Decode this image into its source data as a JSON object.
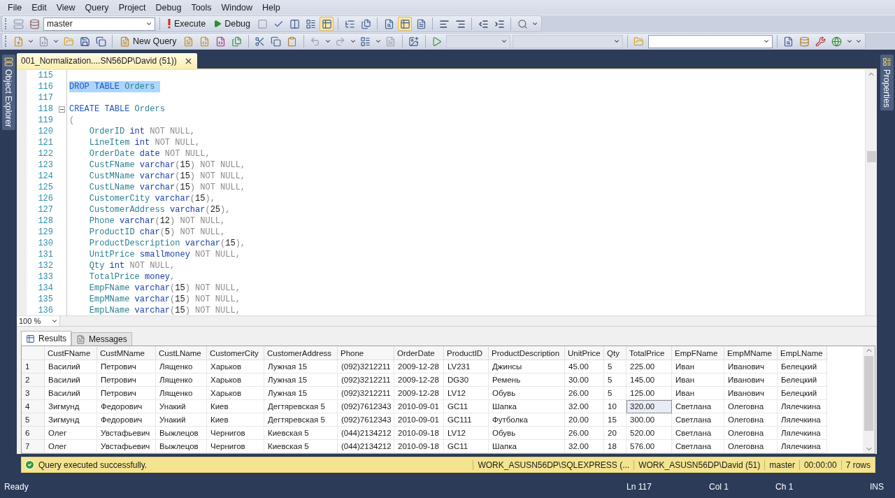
{
  "menu": [
    "File",
    "Edit",
    "View",
    "Query",
    "Project",
    "Debug",
    "Tools",
    "Window",
    "Help"
  ],
  "toolbar_sql": {
    "database": "master",
    "execute": "Execute",
    "debug": "Debug"
  },
  "toolbar_standard": {
    "new_query": "New Query"
  },
  "side_panels": {
    "left": "Object Explorer",
    "right": "Properties"
  },
  "document_tab": {
    "title": "001_Normalization....SN56DP\\David (51))"
  },
  "editor": {
    "zoom": "100 %",
    "lines": [
      {
        "number": "115",
        "selected": false,
        "fold": false
      },
      {
        "number": "116",
        "selected": true,
        "fold": false,
        "tokens": [
          {
            "kind": "keyword",
            "text": "DROP TABLE"
          },
          {
            "kind": "name",
            "text": " Orders "
          }
        ]
      },
      {
        "number": "117",
        "selected": false,
        "fold": false
      },
      {
        "number": "118",
        "selected": false,
        "fold": true,
        "tokens": [
          {
            "kind": "keyword",
            "text": "CREATE TABLE"
          },
          {
            "kind": "name",
            "text": " Orders"
          }
        ]
      },
      {
        "number": "119",
        "selected": false,
        "fold": false,
        "tokens": [
          {
            "kind": "punct",
            "text": "("
          }
        ]
      },
      {
        "number": "120",
        "selected": false,
        "fold": false,
        "tokens": [
          {
            "kind": "name",
            "text": "    OrderID"
          },
          {
            "kind": "type",
            "text": " int"
          },
          {
            "kind": "null",
            "text": " NOT NULL,"
          }
        ]
      },
      {
        "number": "121",
        "selected": false,
        "fold": false,
        "tokens": [
          {
            "kind": "name",
            "text": "    LineItem"
          },
          {
            "kind": "type",
            "text": " int"
          },
          {
            "kind": "null",
            "text": " NOT NULL,"
          }
        ]
      },
      {
        "number": "122",
        "selected": false,
        "fold": false,
        "tokens": [
          {
            "kind": "name",
            "text": "    OrderDate"
          },
          {
            "kind": "type",
            "text": " date"
          },
          {
            "kind": "null",
            "text": " NOT NULL,"
          }
        ]
      },
      {
        "number": "123",
        "selected": false,
        "fold": false,
        "tokens": [
          {
            "kind": "name",
            "text": "    CustFName"
          },
          {
            "kind": "type",
            "text": " varchar"
          },
          {
            "kind": "punct",
            "text": "("
          },
          {
            "kind": "number",
            "text": "15"
          },
          {
            "kind": "punct",
            "text": ")"
          },
          {
            "kind": "null",
            "text": " NOT NULL,"
          }
        ]
      },
      {
        "number": "124",
        "selected": false,
        "fold": false,
        "tokens": [
          {
            "kind": "name",
            "text": "    CustMName"
          },
          {
            "kind": "type",
            "text": " varchar"
          },
          {
            "kind": "punct",
            "text": "("
          },
          {
            "kind": "number",
            "text": "15"
          },
          {
            "kind": "punct",
            "text": ")"
          },
          {
            "kind": "null",
            "text": " NOT NULL,"
          }
        ]
      },
      {
        "number": "125",
        "selected": false,
        "fold": false,
        "tokens": [
          {
            "kind": "name",
            "text": "    CustLName"
          },
          {
            "kind": "type",
            "text": " varchar"
          },
          {
            "kind": "punct",
            "text": "("
          },
          {
            "kind": "number",
            "text": "15"
          },
          {
            "kind": "punct",
            "text": ")"
          },
          {
            "kind": "null",
            "text": " NOT NULL,"
          }
        ]
      },
      {
        "number": "126",
        "selected": false,
        "fold": false,
        "tokens": [
          {
            "kind": "name",
            "text": "    CustomerCity"
          },
          {
            "kind": "type",
            "text": " varchar"
          },
          {
            "kind": "punct",
            "text": "("
          },
          {
            "kind": "number",
            "text": "15"
          },
          {
            "kind": "punct",
            "text": "),"
          }
        ]
      },
      {
        "number": "127",
        "selected": false,
        "fold": false,
        "tokens": [
          {
            "kind": "name",
            "text": "    CustomerAddress"
          },
          {
            "kind": "type",
            "text": " varchar"
          },
          {
            "kind": "punct",
            "text": "("
          },
          {
            "kind": "number",
            "text": "25"
          },
          {
            "kind": "punct",
            "text": "),"
          }
        ]
      },
      {
        "number": "128",
        "selected": false,
        "fold": false,
        "tokens": [
          {
            "kind": "name",
            "text": "    Phone"
          },
          {
            "kind": "type",
            "text": " varchar"
          },
          {
            "kind": "punct",
            "text": "("
          },
          {
            "kind": "number",
            "text": "12"
          },
          {
            "kind": "punct",
            "text": ")"
          },
          {
            "kind": "null",
            "text": " NOT NULL,"
          }
        ]
      },
      {
        "number": "129",
        "selected": false,
        "fold": false,
        "tokens": [
          {
            "kind": "name",
            "text": "    ProductID"
          },
          {
            "kind": "type",
            "text": " char"
          },
          {
            "kind": "punct",
            "text": "("
          },
          {
            "kind": "number",
            "text": "5"
          },
          {
            "kind": "punct",
            "text": ")"
          },
          {
            "kind": "null",
            "text": " NOT NULL,"
          }
        ]
      },
      {
        "number": "130",
        "selected": false,
        "fold": false,
        "tokens": [
          {
            "kind": "name",
            "text": "    ProductDescription"
          },
          {
            "kind": "type",
            "text": " varchar"
          },
          {
            "kind": "punct",
            "text": "("
          },
          {
            "kind": "number",
            "text": "15"
          },
          {
            "kind": "punct",
            "text": "),"
          }
        ]
      },
      {
        "number": "131",
        "selected": false,
        "fold": false,
        "tokens": [
          {
            "kind": "name",
            "text": "    UnitPrice"
          },
          {
            "kind": "type",
            "text": " smallmoney"
          },
          {
            "kind": "null",
            "text": " NOT NULL,"
          }
        ]
      },
      {
        "number": "132",
        "selected": false,
        "fold": false,
        "tokens": [
          {
            "kind": "name",
            "text": "    Qty"
          },
          {
            "kind": "type",
            "text": " int"
          },
          {
            "kind": "null",
            "text": " NOT NULL,"
          }
        ]
      },
      {
        "number": "133",
        "selected": false,
        "fold": false,
        "tokens": [
          {
            "kind": "name",
            "text": "    TotalPrice"
          },
          {
            "kind": "type",
            "text": " money"
          },
          {
            "kind": "punct",
            "text": ","
          }
        ]
      },
      {
        "number": "134",
        "selected": false,
        "fold": false,
        "tokens": [
          {
            "kind": "name",
            "text": "    EmpFName"
          },
          {
            "kind": "type",
            "text": " varchar"
          },
          {
            "kind": "punct",
            "text": "("
          },
          {
            "kind": "number",
            "text": "15"
          },
          {
            "kind": "punct",
            "text": ")"
          },
          {
            "kind": "null",
            "text": " NOT NULL,"
          }
        ]
      },
      {
        "number": "135",
        "selected": false,
        "fold": false,
        "tokens": [
          {
            "kind": "name",
            "text": "    EmpMName"
          },
          {
            "kind": "type",
            "text": " varchar"
          },
          {
            "kind": "punct",
            "text": "("
          },
          {
            "kind": "number",
            "text": "15"
          },
          {
            "kind": "punct",
            "text": ")"
          },
          {
            "kind": "null",
            "text": " NOT NULL,"
          }
        ]
      },
      {
        "number": "136",
        "selected": false,
        "fold": false,
        "tokens": [
          {
            "kind": "name",
            "text": "    EmpLName"
          },
          {
            "kind": "type",
            "text": " varchar"
          },
          {
            "kind": "punct",
            "text": "("
          },
          {
            "kind": "number",
            "text": "15"
          },
          {
            "kind": "punct",
            "text": ")"
          },
          {
            "kind": "null",
            "text": " NOT NULL,"
          }
        ]
      }
    ]
  },
  "result_tabs": [
    {
      "label": "Results",
      "selected": true
    },
    {
      "label": "Messages",
      "selected": false
    }
  ],
  "results_grid": {
    "columns": [
      "CustFName",
      "CustMName",
      "CustLName",
      "CustomerCity",
      "CustomerAddress",
      "Phone",
      "OrderDate",
      "ProductID",
      "ProductDescription",
      "UnitPrice",
      "Qty",
      "TotalPrice",
      "EmpFName",
      "EmpMName",
      "EmpLName"
    ],
    "rows": [
      {
        "number": "1",
        "cells": [
          {
            "text": "Василий",
            "selected": false
          },
          {
            "text": "Петрович",
            "selected": false
          },
          {
            "text": "Лященко",
            "selected": false
          },
          {
            "text": "Харьков",
            "selected": false
          },
          {
            "text": "Лужная 15",
            "selected": false
          },
          {
            "text": "(092)3212211",
            "selected": false
          },
          {
            "text": "2009-12-28",
            "selected": false
          },
          {
            "text": "LV231",
            "selected": false
          },
          {
            "text": "Джинсы",
            "selected": false
          },
          {
            "text": "45.00",
            "selected": false
          },
          {
            "text": "5",
            "selected": false
          },
          {
            "text": "225.00",
            "selected": false
          },
          {
            "text": "Иван",
            "selected": false
          },
          {
            "text": "Иванович",
            "selected": false
          },
          {
            "text": "Белецкий",
            "selected": false
          }
        ]
      },
      {
        "number": "2",
        "cells": [
          {
            "text": "Василий",
            "selected": false
          },
          {
            "text": "Петрович",
            "selected": false
          },
          {
            "text": "Лященко",
            "selected": false
          },
          {
            "text": "Харьков",
            "selected": false
          },
          {
            "text": "Лужная 15",
            "selected": false
          },
          {
            "text": "(092)3212211",
            "selected": false
          },
          {
            "text": "2009-12-28",
            "selected": false
          },
          {
            "text": "DG30",
            "selected": false
          },
          {
            "text": "Ремень",
            "selected": false
          },
          {
            "text": "30.00",
            "selected": false
          },
          {
            "text": "5",
            "selected": false
          },
          {
            "text": "145.00",
            "selected": false
          },
          {
            "text": "Иван",
            "selected": false
          },
          {
            "text": "Иванович",
            "selected": false
          },
          {
            "text": "Белецкий",
            "selected": false
          }
        ]
      },
      {
        "number": "3",
        "cells": [
          {
            "text": "Василий",
            "selected": false
          },
          {
            "text": "Петрович",
            "selected": false
          },
          {
            "text": "Лященко",
            "selected": false
          },
          {
            "text": "Харьков",
            "selected": false
          },
          {
            "text": "Лужная 15",
            "selected": false
          },
          {
            "text": "(092)3212211",
            "selected": false
          },
          {
            "text": "2009-12-28",
            "selected": false
          },
          {
            "text": "LV12",
            "selected": false
          },
          {
            "text": "Обувь",
            "selected": false
          },
          {
            "text": "26.00",
            "selected": false
          },
          {
            "text": "5",
            "selected": false
          },
          {
            "text": "125.00",
            "selected": false
          },
          {
            "text": "Иван",
            "selected": false
          },
          {
            "text": "Иванович",
            "selected": false
          },
          {
            "text": "Белецкий",
            "selected": false
          }
        ]
      },
      {
        "number": "4",
        "cells": [
          {
            "text": "Зигмунд",
            "selected": false
          },
          {
            "text": "Федорович",
            "selected": false
          },
          {
            "text": "Унакий",
            "selected": false
          },
          {
            "text": "Киев",
            "selected": false
          },
          {
            "text": "Дегтяревская 5",
            "selected": false
          },
          {
            "text": "(092)7612343",
            "selected": false
          },
          {
            "text": "2010-09-01",
            "selected": false
          },
          {
            "text": "GC11",
            "selected": false
          },
          {
            "text": "Шапка",
            "selected": false
          },
          {
            "text": "32.00",
            "selected": false
          },
          {
            "text": "10",
            "selected": false
          },
          {
            "text": "320.00",
            "selected": true
          },
          {
            "text": "Светлана",
            "selected": false
          },
          {
            "text": "Олеговна",
            "selected": false
          },
          {
            "text": "Лялечкина",
            "selected": false
          }
        ]
      },
      {
        "number": "5",
        "cells": [
          {
            "text": "Зигмунд",
            "selected": false
          },
          {
            "text": "Федорович",
            "selected": false
          },
          {
            "text": "Унакий",
            "selected": false
          },
          {
            "text": "Киев",
            "selected": false
          },
          {
            "text": "Дегтяревская 5",
            "selected": false
          },
          {
            "text": "(092)7612343",
            "selected": false
          },
          {
            "text": "2010-09-01",
            "selected": false
          },
          {
            "text": "GC111",
            "selected": false
          },
          {
            "text": "Футболка",
            "selected": false
          },
          {
            "text": "20.00",
            "selected": false
          },
          {
            "text": "15",
            "selected": false
          },
          {
            "text": "300.00",
            "selected": false
          },
          {
            "text": "Светлана",
            "selected": false
          },
          {
            "text": "Олеговна",
            "selected": false
          },
          {
            "text": "Лялечкина",
            "selected": false
          }
        ]
      },
      {
        "number": "6",
        "cells": [
          {
            "text": "Олег",
            "selected": false
          },
          {
            "text": "Увстафьевич",
            "selected": false
          },
          {
            "text": "Выжлецов",
            "selected": false
          },
          {
            "text": "Чернигов",
            "selected": false
          },
          {
            "text": "Киевская 5",
            "selected": false
          },
          {
            "text": "(044)2134212",
            "selected": false
          },
          {
            "text": "2010-09-18",
            "selected": false
          },
          {
            "text": "LV12",
            "selected": false
          },
          {
            "text": "Обувь",
            "selected": false
          },
          {
            "text": "26.00",
            "selected": false
          },
          {
            "text": "20",
            "selected": false
          },
          {
            "text": "520.00",
            "selected": false
          },
          {
            "text": "Светлана",
            "selected": false
          },
          {
            "text": "Олеговна",
            "selected": false
          },
          {
            "text": "Лялечкина",
            "selected": false
          }
        ]
      },
      {
        "number": "7",
        "cells": [
          {
            "text": "Олег",
            "selected": false
          },
          {
            "text": "Увстафьевич",
            "selected": false
          },
          {
            "text": "Выжлецов",
            "selected": false
          },
          {
            "text": "Чернигов",
            "selected": false
          },
          {
            "text": "Киевская 5",
            "selected": false
          },
          {
            "text": "(044)2134212",
            "selected": false
          },
          {
            "text": "2010-09-18",
            "selected": false
          },
          {
            "text": "GC11",
            "selected": false
          },
          {
            "text": "Шапка",
            "selected": false
          },
          {
            "text": "32.00",
            "selected": false
          },
          {
            "text": "18",
            "selected": false
          },
          {
            "text": "576.00",
            "selected": false
          },
          {
            "text": "Светлана",
            "selected": false
          },
          {
            "text": "Олеговна",
            "selected": false
          },
          {
            "text": "Лялечкина",
            "selected": false
          }
        ]
      }
    ]
  },
  "query_status": {
    "message": "Query executed successfully.",
    "segments": [
      "WORK_ASUSN56DP\\SQLEXPRESS (...",
      "WORK_ASUSN56DP\\David (51)",
      "master",
      "00:00:00",
      "7 rows"
    ]
  },
  "status_bar": {
    "state": "Ready",
    "line": "Ln 117",
    "column": "Col 1",
    "char": "Ch 1",
    "mode": "INS"
  }
}
